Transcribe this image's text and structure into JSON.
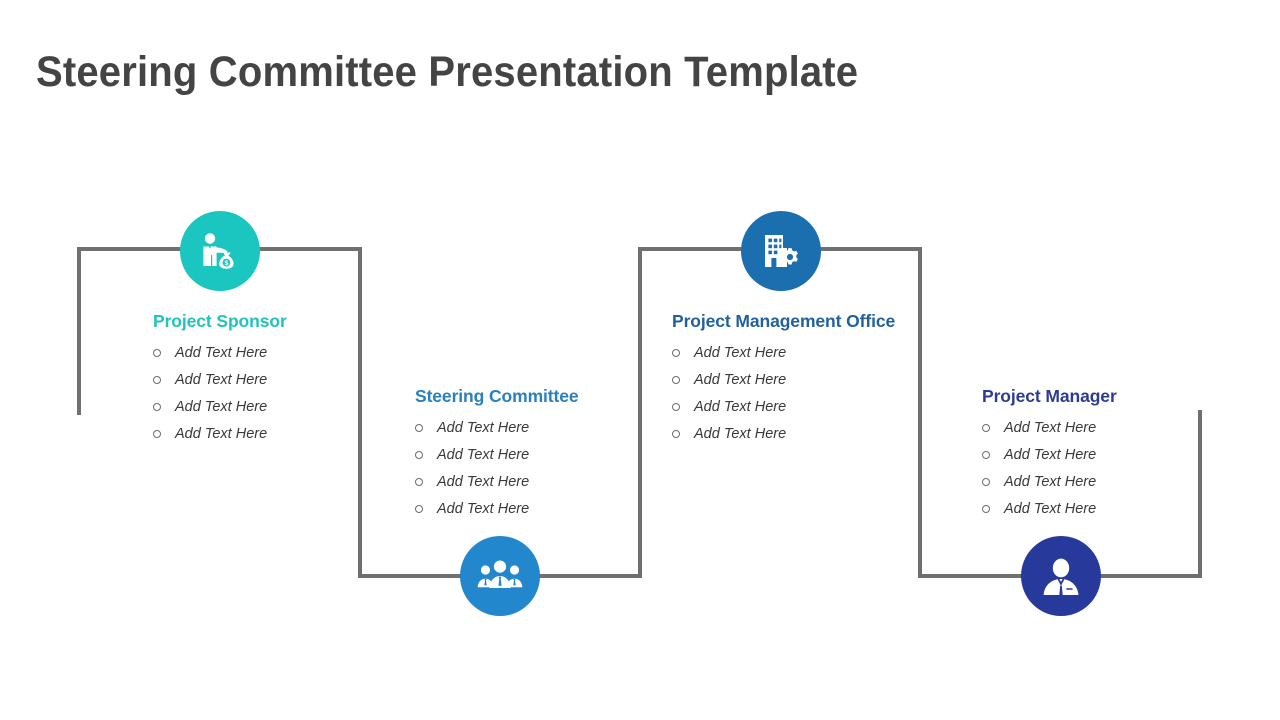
{
  "slide": {
    "title": "Steering Committee Presentation Template",
    "title_color": "#444444",
    "background_color": "#ffffff",
    "connector_color": "#6f7072"
  },
  "nodes": [
    {
      "id": "project-sponsor",
      "heading": "Project Sponsor",
      "heading_color": "#21C3BE",
      "circle_color": "#1CC6C0",
      "icon": "person-with-money-bag-icon",
      "bullets": [
        "Add Text Here",
        "Add Text Here",
        "Add Text Here",
        "Add Text Here"
      ]
    },
    {
      "id": "steering-committee",
      "heading": "Steering Committee",
      "heading_color": "#2A7FC0",
      "circle_color": "#2287CC",
      "icon": "group-of-people-icon",
      "bullets": [
        "Add Text Here",
        "Add Text Here",
        "Add Text Here",
        "Add Text Here"
      ]
    },
    {
      "id": "project-management-office",
      "heading": "Project Management Office",
      "heading_color": "#23619C",
      "circle_color": "#1C6FAF",
      "icon": "building-with-gear-icon",
      "bullets": [
        "Add Text Here",
        "Add Text Here",
        "Add Text Here",
        "Add Text Here"
      ]
    },
    {
      "id": "project-manager",
      "heading": "Project Manager",
      "heading_color": "#2D3C92",
      "circle_color": "#27399B",
      "icon": "single-person-icon",
      "bullets": [
        "Add Text Here",
        "Add Text Here",
        "Add Text Here",
        "Add Text Here"
      ]
    }
  ]
}
